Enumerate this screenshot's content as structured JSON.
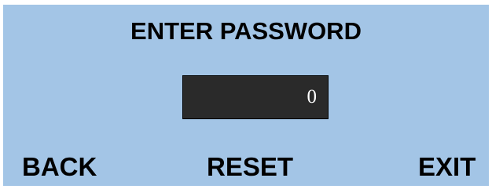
{
  "screen": {
    "title": "ENTER PASSWORD"
  },
  "password_field": {
    "value": "0"
  },
  "footer": {
    "back_label": "BACK",
    "reset_label": "RESET",
    "exit_label": "EXIT"
  },
  "colors": {
    "panel_background": "#a3c5e6",
    "field_background": "#2a2a2a",
    "field_text": "#ffffff",
    "text": "#000000"
  }
}
